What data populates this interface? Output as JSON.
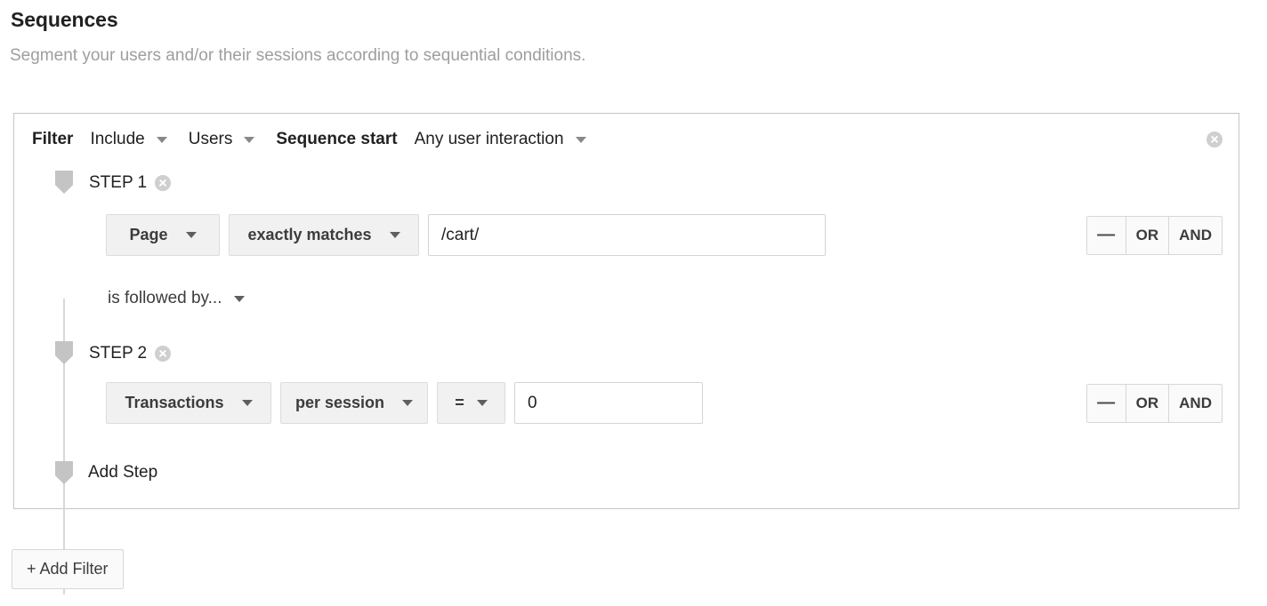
{
  "header": {
    "title": "Sequences",
    "subtitle": "Segment your users and/or their sessions according to sequential conditions."
  },
  "filter": {
    "label": "Filter",
    "scope_include": "Include",
    "scope_target": "Users",
    "sequence_start_label": "Sequence start",
    "sequence_start_value": "Any user interaction",
    "close_icon": "close-circle-icon"
  },
  "steps": [
    {
      "label": "STEP 1",
      "close_icon": "close-circle-icon",
      "dimension": "Page",
      "operator": "exactly matches",
      "value": "/cart/",
      "value_placeholder": "",
      "remove_label": "—",
      "or_label": "OR",
      "and_label": "AND"
    },
    {
      "label": "STEP 2",
      "close_icon": "close-circle-icon",
      "dimension": "Transactions",
      "scope": "per session",
      "comparator": "=",
      "value": "0",
      "value_placeholder": "",
      "remove_label": "—",
      "or_label": "OR",
      "and_label": "AND"
    }
  ],
  "connector": {
    "label": "is followed by..."
  },
  "add_step": {
    "label": "Add Step"
  },
  "add_filter": {
    "label": "+ Add Filter"
  }
}
